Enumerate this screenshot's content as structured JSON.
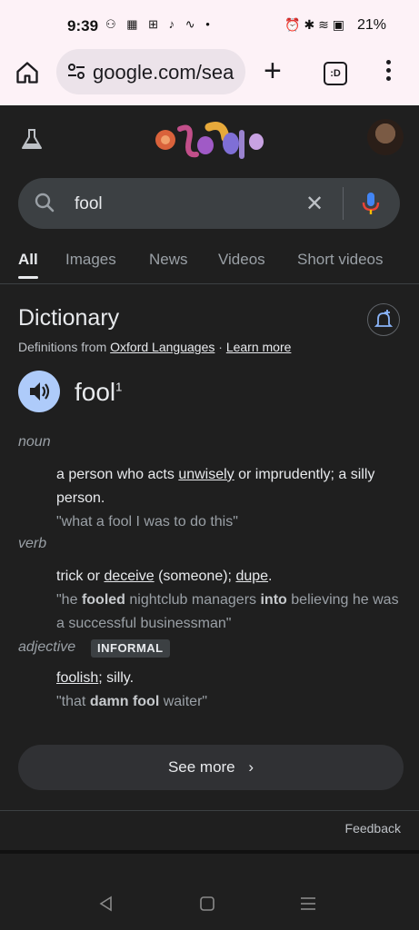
{
  "status_bar": {
    "time": "9:39",
    "left_icons": "⚇ ▦ ⊞ ♪ ∿ •",
    "right_icons": "⏰ ✱ ≋ ▣",
    "battery": "21%"
  },
  "browser": {
    "url": "google.com/sea",
    "tab_count_label": ":D"
  },
  "search": {
    "query": "fool"
  },
  "result_tabs": [
    "All",
    "Images",
    "News",
    "Videos",
    "Short videos"
  ],
  "dictionary": {
    "title": "Dictionary",
    "source_prefix": "Definitions from",
    "source_link": "Oxford Languages",
    "separator": "·",
    "learn_more": "Learn more",
    "word": "fool",
    "superscript": "1",
    "entries": [
      {
        "pos": "noun",
        "def_before": "a person who acts",
        "def_link": "unwisely",
        "def_after": "or imprudently; a silly person.",
        "example": "\"what a fool I was to do this\""
      },
      {
        "pos": "verb",
        "def_before": "trick or",
        "def_link": "deceive",
        "def_middle": "(someone);",
        "def_link2": "dupe",
        "def_after": ".",
        "example_parts": [
          "\"he",
          "fooled",
          "nightclub managers",
          "into",
          "believing he was a successful businessman\""
        ]
      },
      {
        "pos": "adjective",
        "badge": "INFORMAL",
        "def_link": "foolish",
        "def_after": "; silly.",
        "example_parts": [
          "\"that",
          "damn fool",
          "waiter\""
        ]
      }
    ],
    "see_more": "See more",
    "feedback": "Feedback"
  },
  "colors": {
    "background": "#1f1f1f",
    "accent_speaker": "#aecbfa",
    "mic_blue": "#4285f4",
    "mic_red": "#ea4335"
  }
}
